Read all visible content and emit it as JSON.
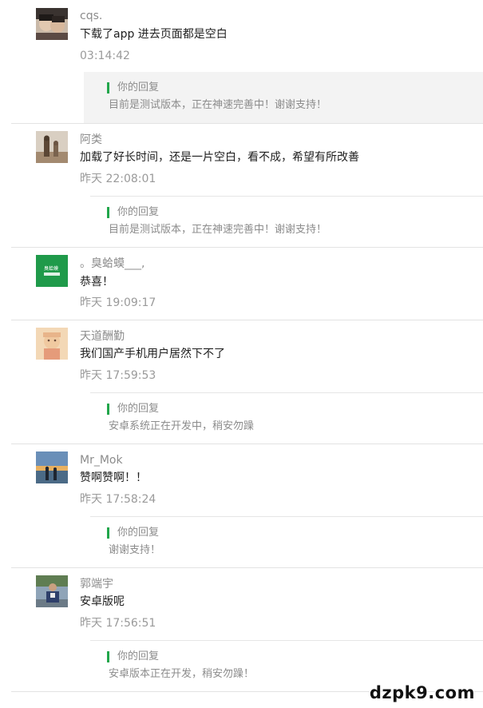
{
  "reply_label": "你的回复",
  "comments": [
    {
      "name": "cqs.",
      "text": "下载了app 进去页面都是空白",
      "time": "03:14:42",
      "reply": "目前是测试版本，正在神速完善中！谢谢支持！"
    },
    {
      "name": "阿类",
      "text": "加载了好长时间，还是一片空白，看不成，希望有所改善",
      "time": "昨天 22:08:01",
      "reply": "目前是测试版本，正在神速完善中！谢谢支持！"
    },
    {
      "name": "。臭蛤蟆___,",
      "text": "恭喜！",
      "time": "昨天 19:09:17",
      "reply": ""
    },
    {
      "name": "天道酬勤",
      "text": "我们国产手机用户居然下不了",
      "time": "昨天 17:59:53",
      "reply": "安卓系统正在开发中，稍安勿躁"
    },
    {
      "name": "Mr_Mok",
      "text": "赞啊赞啊！！",
      "time": "昨天 17:58:24",
      "reply": "谢谢支持！"
    },
    {
      "name": "郭端宇",
      "text": "安卓版呢",
      "time": "昨天 17:56:51",
      "reply": "安卓版本正在开发，稍安勿躁！"
    }
  ],
  "avatar3_text": "臭蛤蟆",
  "watermark": "dzpk9.com",
  "colors": {
    "reply_bar": "#21a64b",
    "avatar3_bg": "#1f9a4a"
  }
}
